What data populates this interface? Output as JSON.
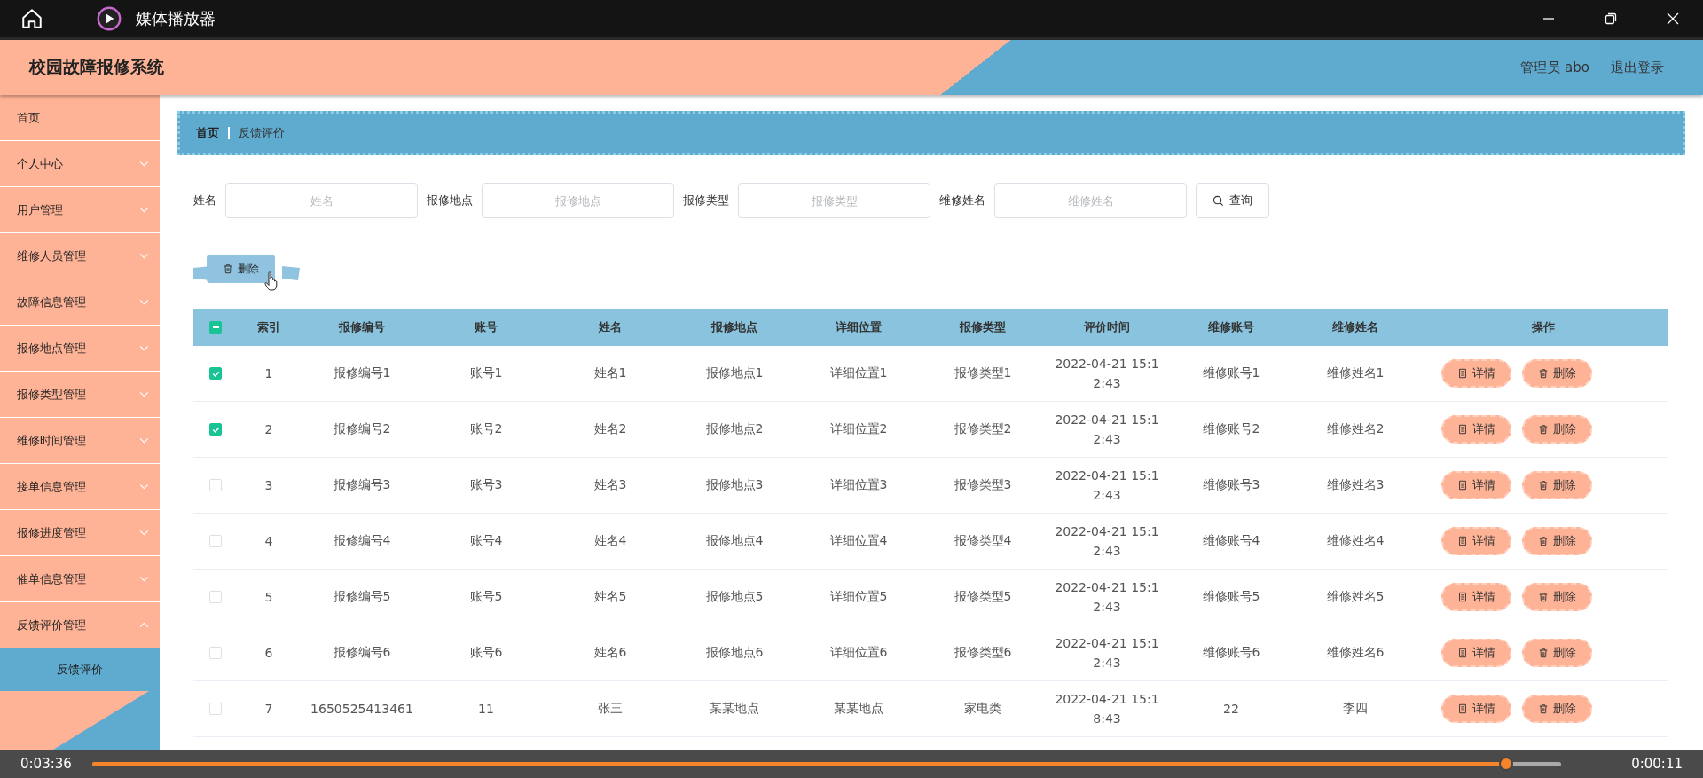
{
  "window": {
    "title": "媒体播放器"
  },
  "header": {
    "title": "校园故障报修系统",
    "user": "管理员 abo",
    "logout": "退出登录"
  },
  "sidebar": [
    {
      "label": "首页",
      "kind": "link"
    },
    {
      "label": "个人中心",
      "kind": "menu",
      "expanded": false
    },
    {
      "label": "用户管理",
      "kind": "menu",
      "expanded": false
    },
    {
      "label": "维修人员管理",
      "kind": "menu",
      "expanded": false
    },
    {
      "label": "故障信息管理",
      "kind": "menu",
      "expanded": false
    },
    {
      "label": "报修地点管理",
      "kind": "menu",
      "expanded": false
    },
    {
      "label": "报修类型管理",
      "kind": "menu",
      "expanded": false
    },
    {
      "label": "维修时间管理",
      "kind": "menu",
      "expanded": false
    },
    {
      "label": "接单信息管理",
      "kind": "menu",
      "expanded": false
    },
    {
      "label": "报修进度管理",
      "kind": "menu",
      "expanded": false
    },
    {
      "label": "催单信息管理",
      "kind": "menu",
      "expanded": false
    },
    {
      "label": "反馈评价管理",
      "kind": "menu",
      "expanded": true,
      "children": [
        {
          "label": "反馈评价",
          "selected": true
        }
      ]
    }
  ],
  "breadcrumb": [
    "首页",
    "反馈评价"
  ],
  "search": {
    "fields": [
      {
        "label": "姓名",
        "placeholder": "姓名"
      },
      {
        "label": "报修地点",
        "placeholder": "报修地点"
      },
      {
        "label": "报修类型",
        "placeholder": "报修类型"
      },
      {
        "label": "维修姓名",
        "placeholder": "维修姓名"
      }
    ],
    "button": "查询"
  },
  "toolbar": {
    "delete": "删除"
  },
  "table": {
    "header_checkbox": {
      "indeterminate": true
    },
    "columns": [
      "索引",
      "报修编号",
      "账号",
      "姓名",
      "报修地点",
      "详细位置",
      "报修类型",
      "评价时间",
      "维修账号",
      "维修姓名",
      "操作"
    ],
    "rows": [
      {
        "checked": true,
        "cells": [
          "1",
          "报修编号1",
          "账号1",
          "姓名1",
          "报修地点1",
          "详细位置1",
          "报修类型1",
          "2022-04-21 15:12:43",
          "维修账号1",
          "维修姓名1"
        ],
        "actions": [
          "详情",
          "删除"
        ]
      },
      {
        "checked": true,
        "cells": [
          "2",
          "报修编号2",
          "账号2",
          "姓名2",
          "报修地点2",
          "详细位置2",
          "报修类型2",
          "2022-04-21 15:12:43",
          "维修账号2",
          "维修姓名2"
        ],
        "actions": [
          "详情",
          "删除"
        ]
      },
      {
        "checked": false,
        "cells": [
          "3",
          "报修编号3",
          "账号3",
          "姓名3",
          "报修地点3",
          "详细位置3",
          "报修类型3",
          "2022-04-21 15:12:43",
          "维修账号3",
          "维修姓名3"
        ],
        "actions": [
          "详情",
          "删除"
        ]
      },
      {
        "checked": false,
        "cells": [
          "4",
          "报修编号4",
          "账号4",
          "姓名4",
          "报修地点4",
          "详细位置4",
          "报修类型4",
          "2022-04-21 15:12:43",
          "维修账号4",
          "维修姓名4"
        ],
        "actions": [
          "详情",
          "删除"
        ]
      },
      {
        "checked": false,
        "cells": [
          "5",
          "报修编号5",
          "账号5",
          "姓名5",
          "报修地点5",
          "详细位置5",
          "报修类型5",
          "2022-04-21 15:12:43",
          "维修账号5",
          "维修姓名5"
        ],
        "actions": [
          "详情",
          "删除"
        ]
      },
      {
        "checked": false,
        "cells": [
          "6",
          "报修编号6",
          "账号6",
          "姓名6",
          "报修地点6",
          "详细位置6",
          "报修类型6",
          "2022-04-21 15:12:43",
          "维修账号6",
          "维修姓名6"
        ],
        "actions": [
          "详情",
          "删除"
        ]
      },
      {
        "checked": false,
        "cells": [
          "7",
          "1650525413461",
          "11",
          "张三",
          "某某地点",
          "某某地点",
          "家电类",
          "2022-04-21 15:18:43",
          "22",
          "李四"
        ],
        "actions": [
          "详情",
          "删除"
        ]
      }
    ]
  },
  "player": {
    "elapsed": "0:03:36",
    "remaining": "0:00:11",
    "level": 0.967
  }
}
